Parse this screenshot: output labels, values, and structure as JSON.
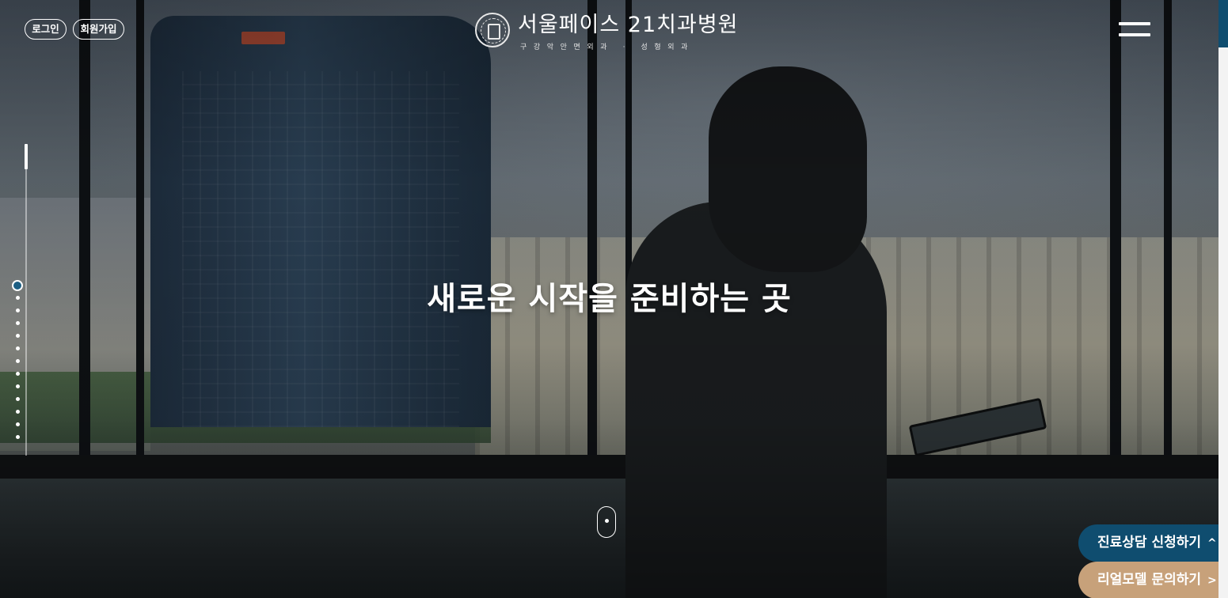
{
  "header": {
    "login_label": "로그인",
    "join_label": "회원가입",
    "logo_title": "서울페이스 21치과병원",
    "logo_subtitle": "구강악안면외과 · 성형외과",
    "menu_icon": "hamburger-menu-icon"
  },
  "hero": {
    "headline": "새로운 시작을 준비하는 곳",
    "slides_total": 13,
    "active_slide": 1
  },
  "cta": {
    "consult_label": "진료상담 신청하기",
    "consult_arrow": "^",
    "model_label": "리얼모델 문의하기",
    "model_arrow": ">"
  },
  "colors": {
    "accent_navy": "#0f4d6f",
    "accent_gold": "#c7a17a"
  }
}
